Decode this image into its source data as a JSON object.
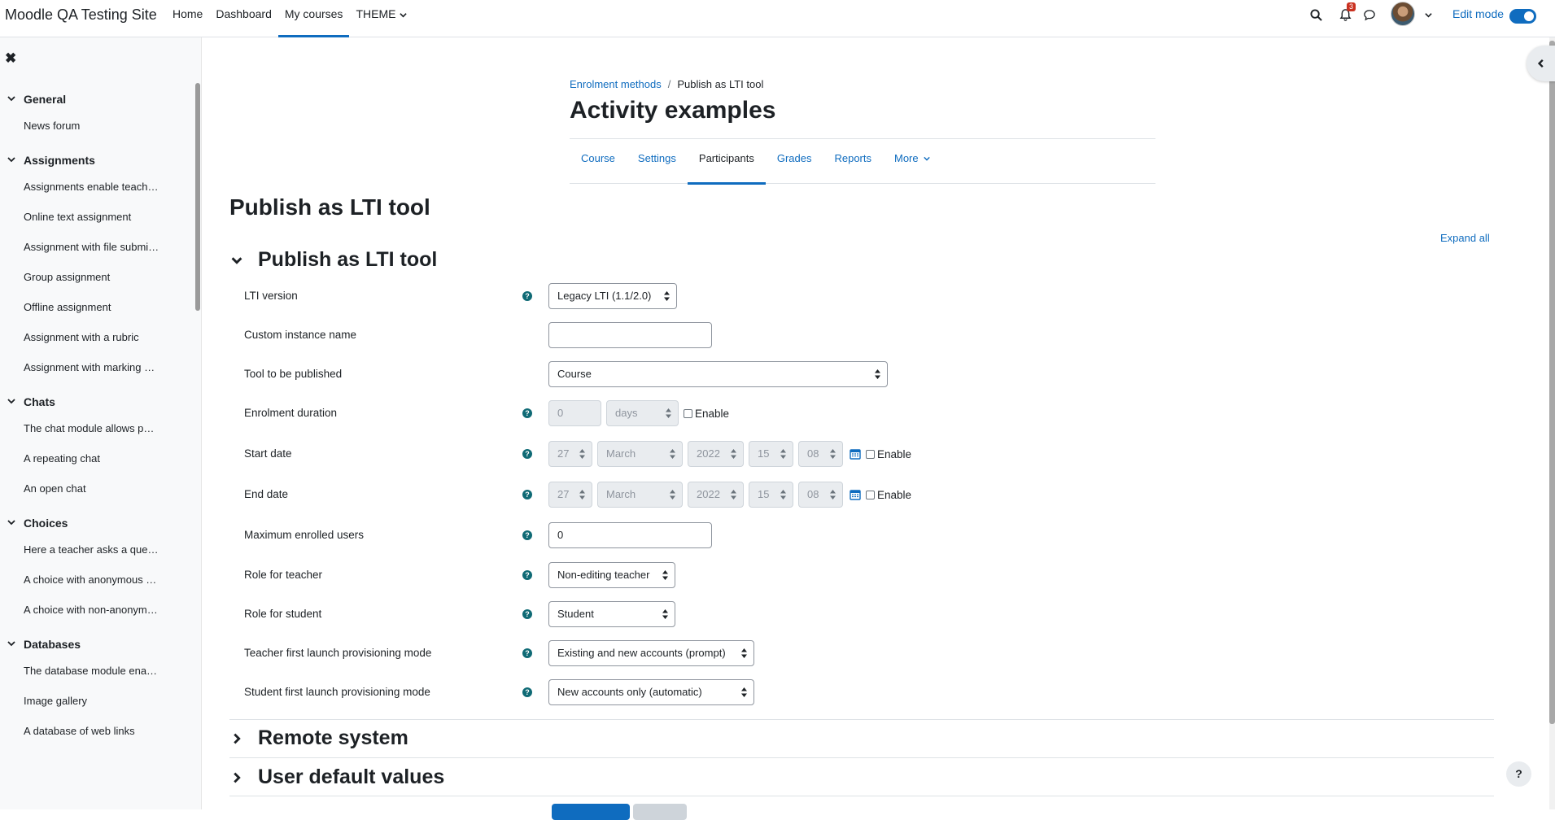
{
  "site": {
    "name": "Moodle QA Testing Site"
  },
  "primary_nav": [
    {
      "label": "Home"
    },
    {
      "label": "Dashboard"
    },
    {
      "label": "My courses",
      "active": true
    },
    {
      "label": "THEME",
      "dropdown": true
    }
  ],
  "notifications": {
    "count": "3"
  },
  "edit_mode": {
    "label": "Edit mode",
    "on": true
  },
  "course_index": {
    "sections": [
      {
        "title": "General",
        "items": [
          "News forum"
        ]
      },
      {
        "title": "Assignments",
        "items": [
          "Assignments enable teach…",
          "Online text assignment",
          "Assignment with file submi…",
          "Group assignment",
          "Offline assignment",
          "Assignment with a rubric",
          "Assignment with marking …"
        ]
      },
      {
        "title": "Chats",
        "items": [
          "The chat module allows p…",
          "A repeating chat",
          "An open chat"
        ]
      },
      {
        "title": "Choices",
        "items": [
          "Here a teacher asks a que…",
          "A choice with anonymous …",
          "A choice with non-anonym…"
        ]
      },
      {
        "title": "Databases",
        "items": [
          "The database module ena…",
          "Image gallery",
          "A database of web links"
        ]
      }
    ]
  },
  "breadcrumb": {
    "parent": "Enrolment methods",
    "separator": "/",
    "current": "Publish as LTI tool"
  },
  "course": {
    "title": "Activity examples"
  },
  "secondary_nav": {
    "tabs": [
      {
        "label": "Course"
      },
      {
        "label": "Settings"
      },
      {
        "label": "Participants",
        "active": true
      },
      {
        "label": "Grades"
      },
      {
        "label": "Reports"
      },
      {
        "label": "More",
        "dropdown": true
      }
    ]
  },
  "page": {
    "heading": "Publish as LTI tool",
    "expand_all": "Expand all"
  },
  "fieldsets": {
    "main": "Publish as LTI tool",
    "remote": "Remote system",
    "defaults": "User default values"
  },
  "form": {
    "lti_version": {
      "label": "LTI version",
      "value": "Legacy LTI (1.1/2.0)"
    },
    "custom_name": {
      "label": "Custom instance name",
      "value": ""
    },
    "tool": {
      "label": "Tool to be published",
      "value": "Course"
    },
    "enrol_duration": {
      "label": "Enrolment duration",
      "value": "0",
      "unit": "days",
      "enable": "Enable"
    },
    "start_date": {
      "label": "Start date",
      "day": "27",
      "month": "March",
      "year": "2022",
      "hour": "15",
      "minute": "08",
      "enable": "Enable"
    },
    "end_date": {
      "label": "End date",
      "day": "27",
      "month": "March",
      "year": "2022",
      "hour": "15",
      "minute": "08",
      "enable": "Enable"
    },
    "max_users": {
      "label": "Maximum enrolled users",
      "value": "0"
    },
    "role_teacher": {
      "label": "Role for teacher",
      "value": "Non-editing teacher"
    },
    "role_student": {
      "label": "Role for student",
      "value": "Student"
    },
    "teacher_provisioning": {
      "label": "Teacher first launch provisioning mode",
      "value": "Existing and new accounts (prompt)"
    },
    "student_provisioning": {
      "label": "Student first launch provisioning mode",
      "value": "New accounts only (automatic)"
    }
  },
  "colors": {
    "accent": "#0f6cbf",
    "help_icon": "#0f6a75",
    "badge": "#ca3120"
  },
  "help_button": {
    "label": "?"
  }
}
